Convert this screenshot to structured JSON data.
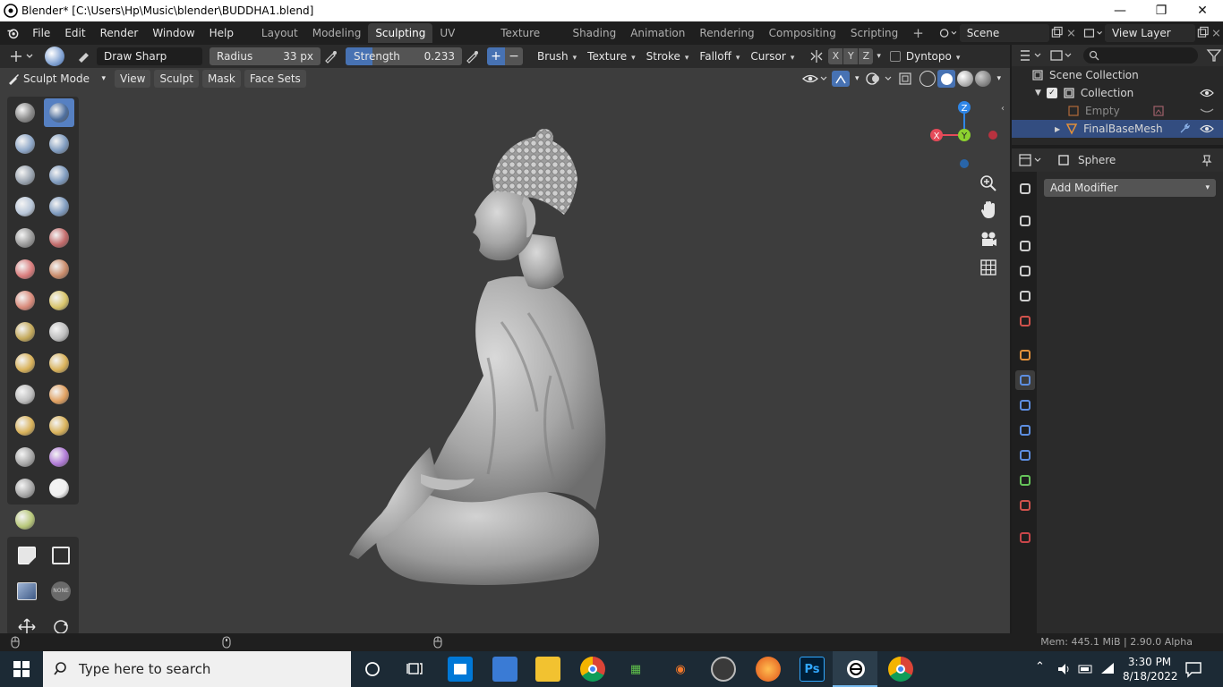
{
  "titlebar": {
    "title": "Blender* [C:\\Users\\Hp\\Music\\blender\\BUDDHA1.blend]",
    "minimize": "—",
    "restore": "❐",
    "close": "✕"
  },
  "menu": [
    "File",
    "Edit",
    "Render",
    "Window",
    "Help"
  ],
  "workspaces": [
    "Layout",
    "Modeling",
    "Sculpting",
    "UV Editing",
    "Texture Paint",
    "Shading",
    "Animation",
    "Rendering",
    "Compositing",
    "Scripting"
  ],
  "active_workspace": "Sculpting",
  "add_workspace": "+",
  "scene": "Scene",
  "view_layer": "View Layer",
  "tool_header": {
    "brush_name": "Draw Sharp",
    "radius_label": "Radius",
    "radius_value": "33 px",
    "strength_label": "Strength",
    "strength_value": "0.233",
    "strength_fraction": 0.233,
    "dropdowns": [
      "Brush",
      "Texture",
      "Stroke",
      "Falloff",
      "Cursor"
    ],
    "axes": [
      "X",
      "Y",
      "Z"
    ],
    "dyntopo": "Dyntopo",
    "plus": "+",
    "minus": "−"
  },
  "viewport_header": {
    "mode": "Sculpt Mode",
    "menus": [
      "View",
      "Sculpt",
      "Mask",
      "Face Sets"
    ]
  },
  "gizmo": {
    "z": "Z",
    "y": "Y",
    "x": "X"
  },
  "outliner": {
    "root": "Scene Collection",
    "collection": "Collection",
    "items": [
      "Empty",
      "FinalBaseMesh"
    ]
  },
  "properties": {
    "object_name": "Sphere",
    "add_modifier": "Add Modifier"
  },
  "statusbar": {
    "right": "Mem: 445.1 MiB | 2.90.0 Alpha"
  },
  "taskbar": {
    "search_placeholder": "Type here to search",
    "time": "3:30 PM",
    "date": "8/18/2022",
    "ps_label": "Ps"
  },
  "colors": {
    "accent": "#5680c2",
    "viewport_bg": "#3d3d3d",
    "gizmo_x": "#e64a59",
    "gizmo_y": "#8cd12f",
    "gizmo_z": "#2f86e6"
  }
}
